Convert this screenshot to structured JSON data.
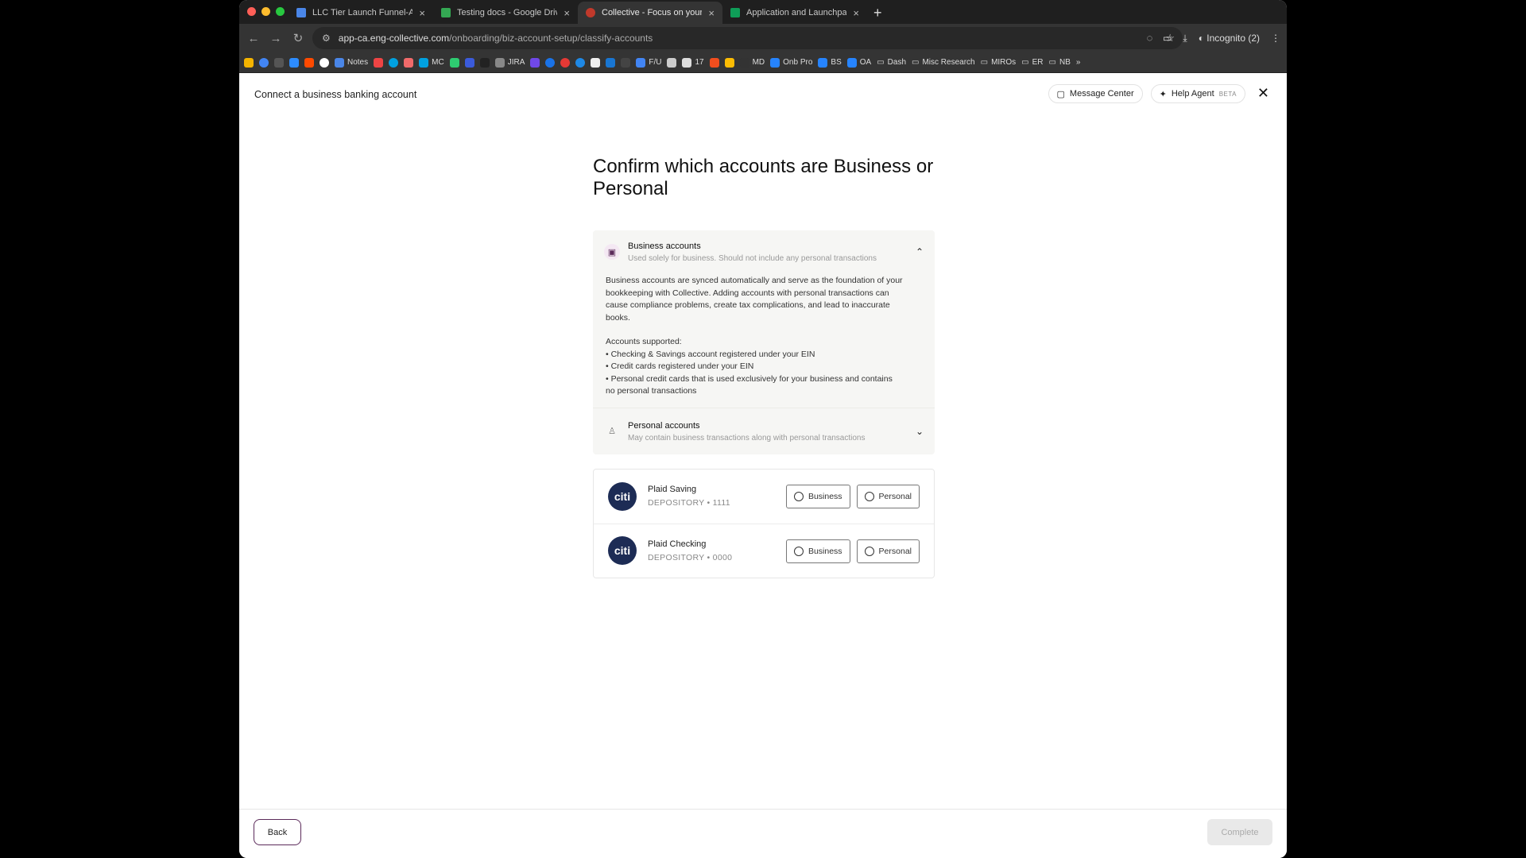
{
  "browser": {
    "tabs": [
      {
        "title": "LLC Tier Launch Funnel-App",
        "icon_color": "#4a86e8"
      },
      {
        "title": "Testing docs - Google Drive",
        "icon_color": "#34a853"
      },
      {
        "title": "Collective - Focus on your pa",
        "icon_color": "#c0392b"
      },
      {
        "title": "Application and Launchpad l",
        "icon_color": "#0f9d58"
      }
    ],
    "url_host": "app-ca.eng-collective.com",
    "url_path": "/onboarding/biz-account-setup/classify-accounts",
    "incognito_label": "Incognito (2)",
    "bookmarks": [
      "Notes",
      "MC",
      "JIRA",
      "F/U",
      "17",
      "MD",
      "Onb Pro",
      "BS",
      "OA",
      "Dash",
      "Misc Research",
      "MIROs",
      "ER",
      "NB"
    ]
  },
  "header": {
    "title": "Connect a business banking account",
    "message_center": "Message Center",
    "help_agent": "Help Agent",
    "beta": "BETA"
  },
  "main": {
    "heading": "Confirm which accounts are Business or Personal",
    "business": {
      "title": "Business accounts",
      "subtitle": "Used solely for business. Should not include any personal transactions",
      "description": "Business accounts are synced automatically and serve as the foundation of your bookkeeping with Collective. Adding accounts with personal transactions can cause compliance problems, create tax complications, and lead to inaccurate books.",
      "supported_heading": "Accounts supported:",
      "supported": [
        "• Checking & Savings account registered under your EIN",
        "• Credit cards registered under your EIN",
        "• Personal credit cards that is used exclusively for your business and contains no personal transactions"
      ]
    },
    "personal": {
      "title": "Personal accounts",
      "subtitle": "May contain business transactions along with personal transactions"
    },
    "accounts": [
      {
        "logo": "citi",
        "name": "Plaid Saving",
        "meta": "DEPOSITORY  •  1111",
        "business_label": "Business",
        "personal_label": "Personal"
      },
      {
        "logo": "citi",
        "name": "Plaid Checking",
        "meta": "DEPOSITORY  •  0000",
        "business_label": "Business",
        "personal_label": "Personal"
      }
    ]
  },
  "footer": {
    "back": "Back",
    "complete": "Complete"
  },
  "colors": {
    "brand": "#5b2a5a",
    "bank_logo": "#1d2c55"
  }
}
